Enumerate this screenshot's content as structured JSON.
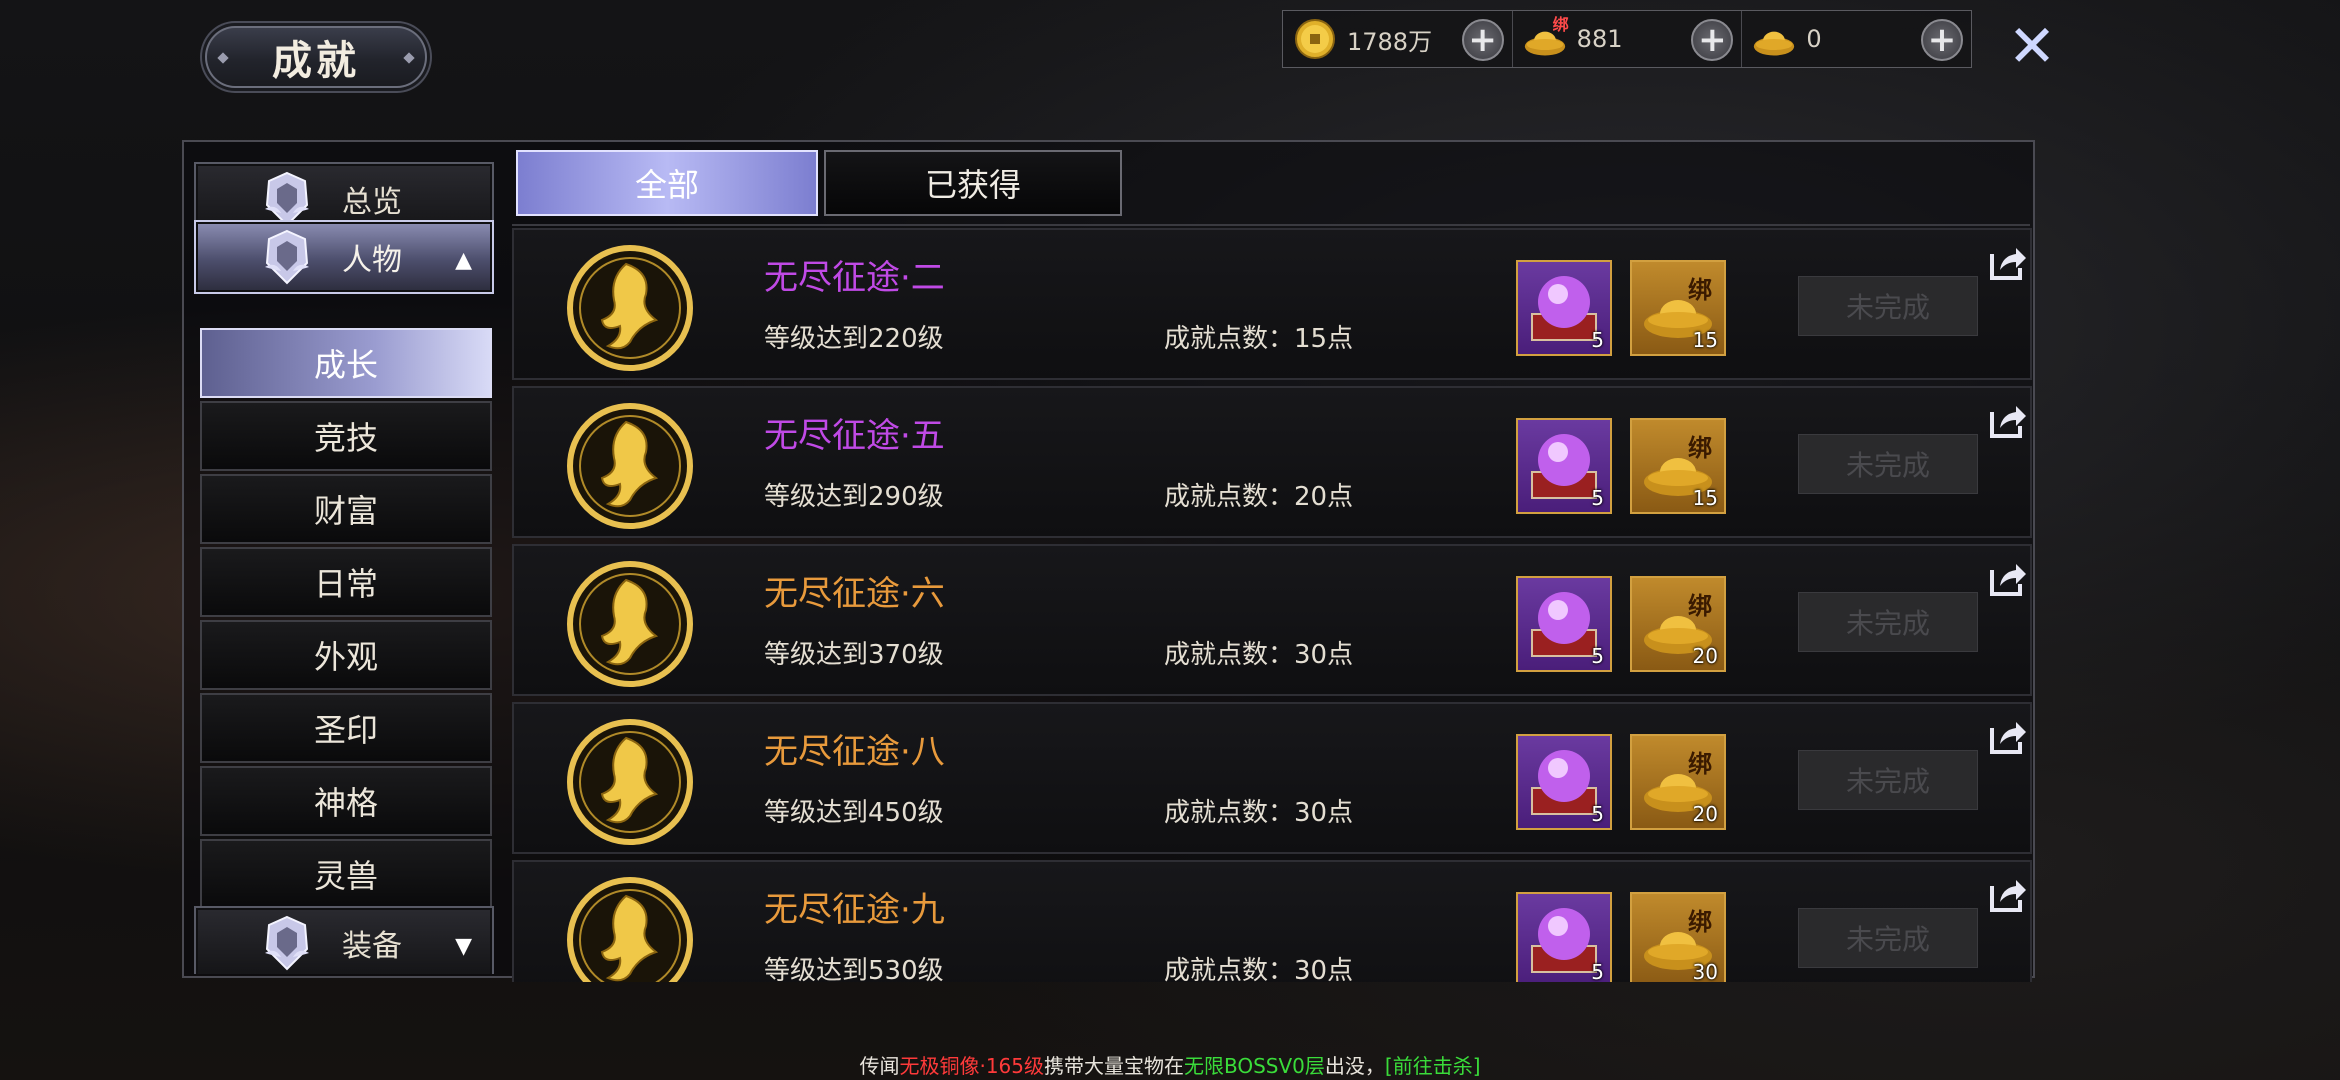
{
  "header": {
    "title": "成就",
    "close_icon": "close-icon"
  },
  "currency": [
    {
      "icon": "copper-coin-icon",
      "value": "1788万",
      "tag": ""
    },
    {
      "icon": "bound-ingot-icon",
      "value": "881",
      "tag": "绑"
    },
    {
      "icon": "gold-ingot-icon",
      "value": "0",
      "tag": ""
    }
  ],
  "sidebar": {
    "categories": [
      {
        "label": "总览",
        "expanded": false,
        "chevron": ""
      },
      {
        "label": "人物",
        "expanded": true,
        "chevron": "▲"
      },
      {
        "label": "装备",
        "expanded": false,
        "chevron": "▼"
      }
    ],
    "subitems": [
      {
        "label": "成长",
        "active": true
      },
      {
        "label": "竞技",
        "active": false
      },
      {
        "label": "财富",
        "active": false
      },
      {
        "label": "日常",
        "active": false
      },
      {
        "label": "外观",
        "active": false
      },
      {
        "label": "圣印",
        "active": false
      },
      {
        "label": "神格",
        "active": false
      },
      {
        "label": "灵兽",
        "active": false
      }
    ]
  },
  "tabs": [
    {
      "label": "全部",
      "active": true
    },
    {
      "label": "已获得",
      "active": false
    }
  ],
  "colors": {
    "title_purple": "#c04ae6",
    "title_orange": "#e89a3c"
  },
  "achievements": [
    {
      "title": "无尽征途·二",
      "title_color": "#c04ae6",
      "desc": "等级达到220级",
      "points": "成就点数：15点",
      "reward1_count": "5",
      "reward2_tag": "绑",
      "reward2_count": "15",
      "status": "未完成"
    },
    {
      "title": "无尽征途·五",
      "title_color": "#c04ae6",
      "desc": "等级达到290级",
      "points": "成就点数：20点",
      "reward1_count": "5",
      "reward2_tag": "绑",
      "reward2_count": "15",
      "status": "未完成"
    },
    {
      "title": "无尽征途·六",
      "title_color": "#e89a3c",
      "desc": "等级达到370级",
      "points": "成就点数：30点",
      "reward1_count": "5",
      "reward2_tag": "绑",
      "reward2_count": "20",
      "status": "未完成"
    },
    {
      "title": "无尽征途·八",
      "title_color": "#e89a3c",
      "desc": "等级达到450级",
      "points": "成就点数：30点",
      "reward1_count": "5",
      "reward2_tag": "绑",
      "reward2_count": "20",
      "status": "未完成"
    },
    {
      "title": "无尽征途·九",
      "title_color": "#e89a3c",
      "desc": "等级达到530级",
      "points": "成就点数：30点",
      "reward1_count": "5",
      "reward2_tag": "绑",
      "reward2_count": "30",
      "status": "未完成"
    }
  ],
  "broadcast": {
    "prefix": "传闻",
    "name": "无极铜像",
    "level": "·165级",
    "middle": "携带大量宝物在",
    "location": "无限BOSSV0层",
    "suffix": "出没，",
    "link": "[前往击杀]"
  }
}
